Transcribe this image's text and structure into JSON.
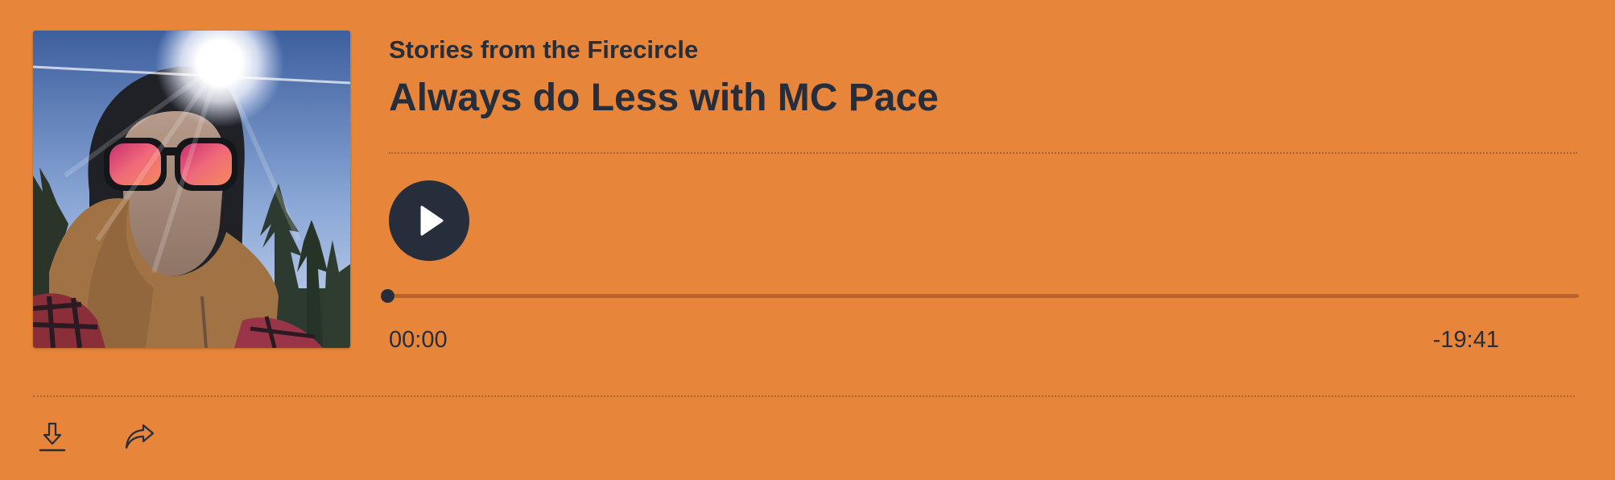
{
  "episode": {
    "show_title": "Stories from the Firecircle",
    "title": "Always do Less with MC Pace"
  },
  "playback": {
    "state": "paused",
    "elapsed": "00:00",
    "remaining": "-19:41",
    "progress": 0
  },
  "actions": {
    "download_icon": "download-icon",
    "share_icon": "share-icon"
  },
  "colors": {
    "background": "#e7863a",
    "text": "#262d3b",
    "track": "#b9632a"
  }
}
